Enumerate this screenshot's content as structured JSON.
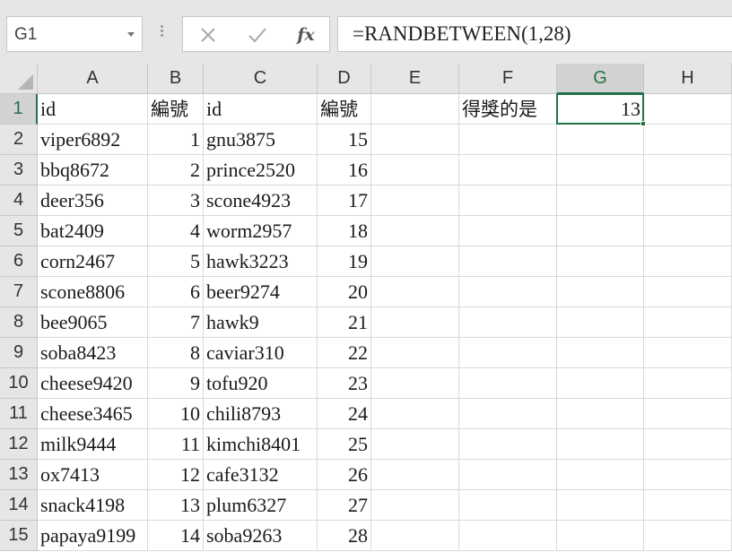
{
  "name_box": {
    "value": "G1"
  },
  "formula_bar": {
    "cancel_icon": "close-icon",
    "enter_icon": "check-icon",
    "fx_label": "fx",
    "formula": "=RANDBETWEEN(1,28)"
  },
  "columns": [
    "A",
    "B",
    "C",
    "D",
    "E",
    "F",
    "G",
    "H"
  ],
  "selected_column": "G",
  "rows": [
    "1",
    "2",
    "3",
    "4",
    "5",
    "6",
    "7",
    "8",
    "9",
    "10",
    "11",
    "12",
    "13",
    "14",
    "15"
  ],
  "selected_row": "1",
  "headers": {
    "a": "id",
    "b": "編號",
    "c": "id",
    "d": "編號",
    "f": "得獎的是",
    "g": "13"
  },
  "table": [
    {
      "a": "viper6892",
      "b": "1",
      "c": "gnu3875",
      "d": "15"
    },
    {
      "a": "bbq8672",
      "b": "2",
      "c": "prince2520",
      "d": "16"
    },
    {
      "a": "deer356",
      "b": "3",
      "c": "scone4923",
      "d": "17"
    },
    {
      "a": "bat2409",
      "b": "4",
      "c": "worm2957",
      "d": "18"
    },
    {
      "a": "corn2467",
      "b": "5",
      "c": "hawk3223",
      "d": "19"
    },
    {
      "a": "scone8806",
      "b": "6",
      "c": "beer9274",
      "d": "20"
    },
    {
      "a": "bee9065",
      "b": "7",
      "c": "hawk9",
      "d": "21"
    },
    {
      "a": "soba8423",
      "b": "8",
      "c": "caviar310",
      "d": "22"
    },
    {
      "a": "cheese9420",
      "b": "9",
      "c": "tofu920",
      "d": "23"
    },
    {
      "a": "cheese3465",
      "b": "10",
      "c": "chili8793",
      "d": "24"
    },
    {
      "a": "milk9444",
      "b": "11",
      "c": "kimchi8401",
      "d": "25"
    },
    {
      "a": "ox7413",
      "b": "12",
      "c": "cafe3132",
      "d": "26"
    },
    {
      "a": "snack4198",
      "b": "13",
      "c": "plum6327",
      "d": "27"
    },
    {
      "a": "papaya9199",
      "b": "14",
      "c": "soba9263",
      "d": "28"
    }
  ],
  "colors": {
    "accent": "#217346",
    "header_bg": "#e6e6e6",
    "grid_line": "#d9d9d9"
  }
}
